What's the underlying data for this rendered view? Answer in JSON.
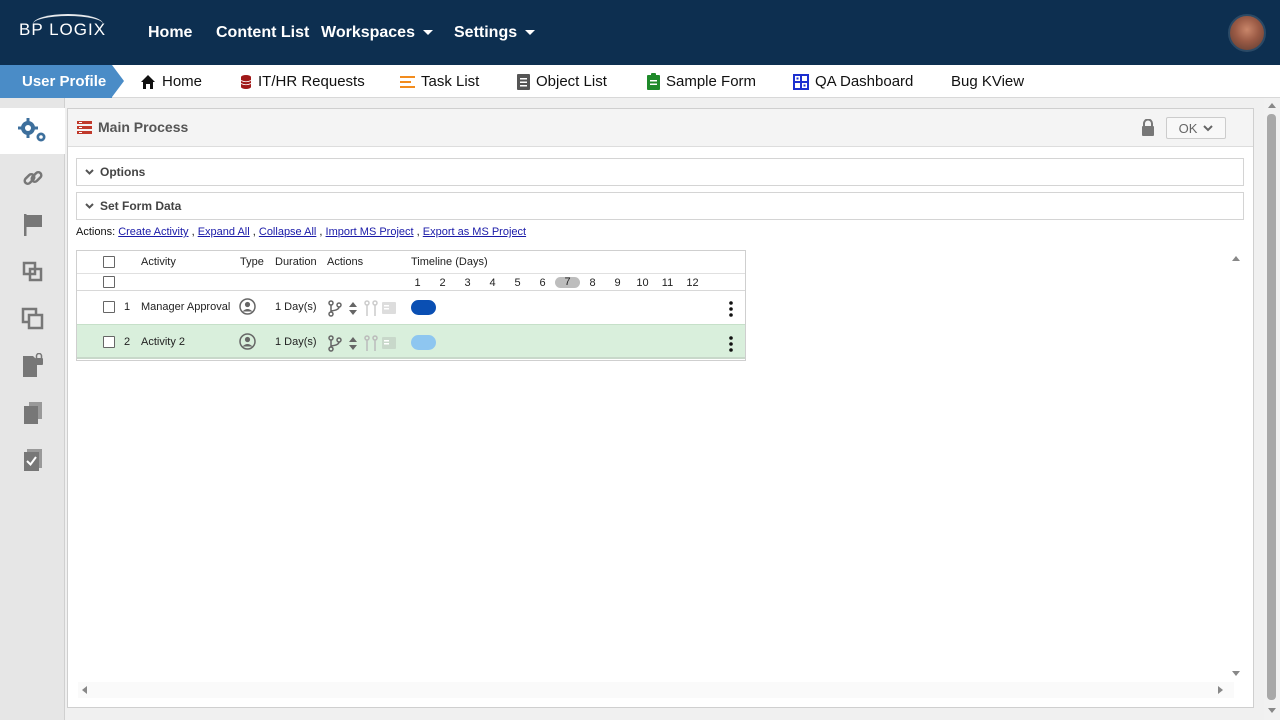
{
  "brand": {
    "logo_text": "BP LOGIX"
  },
  "topnav": {
    "home": "Home",
    "content_list": "Content List",
    "workspaces": "Workspaces",
    "settings": "Settings"
  },
  "tabs": {
    "user_profile": "User Profile",
    "home": "Home",
    "ithr": "IT/HR Requests",
    "task_list": "Task List",
    "object_list": "Object List",
    "sample_form": "Sample Form",
    "qa_dashboard": "QA Dashboard",
    "bug_kview": "Bug KView"
  },
  "sidebar": {
    "icons": [
      "gears-icon",
      "link-icon",
      "flag-icon",
      "nested-squares-icon",
      "copy-squares-icon",
      "locked-document-icon",
      "documents-icon",
      "checked-document-icon"
    ]
  },
  "panel": {
    "title": "Main Process",
    "ok_label": "OK",
    "options_label": "Options",
    "set_form_data_label": "Set Form Data",
    "actions_prefix": "Actions:",
    "actions": [
      "Create Activity",
      "Expand All",
      "Collapse All",
      "Import MS Project",
      "Export as MS Project"
    ],
    "separator": ","
  },
  "grid": {
    "headers": {
      "activity": "Activity",
      "type": "Type",
      "duration": "Duration",
      "actions": "Actions",
      "timeline": "Timeline (Days)"
    },
    "days": [
      "1",
      "2",
      "3",
      "4",
      "5",
      "6",
      "7",
      "8",
      "9",
      "10",
      "11",
      "12"
    ],
    "today_index": 6,
    "rows": [
      {
        "num": "1",
        "activity": "Manager Approval",
        "duration": "1 Day(s)",
        "start_day": 1,
        "bar_color": "#0a4fb3",
        "selected": false
      },
      {
        "num": "2",
        "activity": "Activity 2",
        "duration": "1 Day(s)",
        "start_day": 1,
        "bar_color": "#8ec6f0",
        "selected": true
      }
    ]
  },
  "colors": {
    "navbar": "#0d2f50",
    "profile_tab": "#4a8cc7",
    "selected_row": "#d9efdc"
  }
}
